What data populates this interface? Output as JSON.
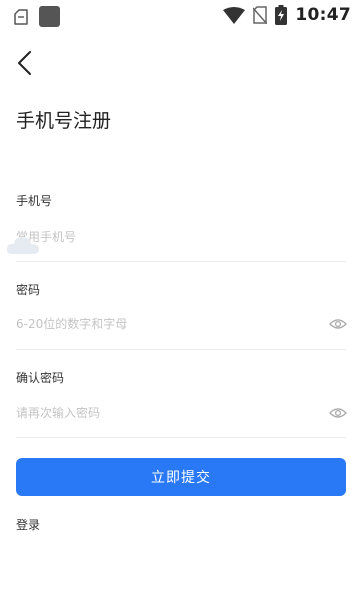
{
  "status_bar": {
    "time": "10:47",
    "icons": [
      "notification-outline-icon",
      "app-square-icon",
      "wifi-icon",
      "no-sim-icon",
      "battery-charging-icon"
    ]
  },
  "header": {
    "title": "手机号注册"
  },
  "form": {
    "phone_label": "手机号",
    "phone_placeholder": "常用手机号",
    "password_label": "密码",
    "password_placeholder": "6-20位的数字和字母",
    "confirm_label": "确认密码",
    "confirm_placeholder": "请再次输入密码",
    "submit_label": "立即提交",
    "login_link": "登录"
  },
  "colors": {
    "accent": "#2979f6",
    "placeholder": "#c4c4c4",
    "divider": "#ececec"
  }
}
